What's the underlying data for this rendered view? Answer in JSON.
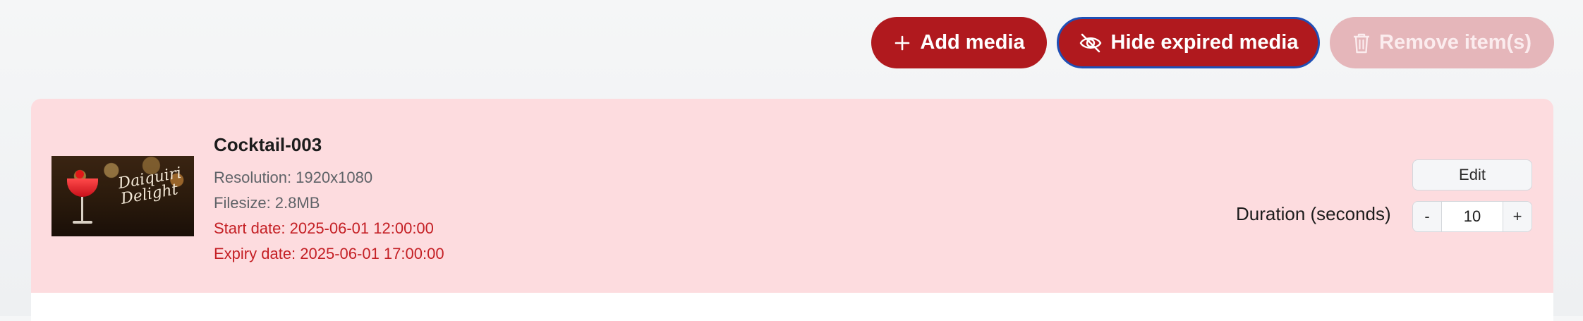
{
  "toolbar": {
    "add_label": "Add media",
    "hide_label": "Hide expired media",
    "remove_label": "Remove item(s)",
    "add_icon": "plus-icon",
    "hide_icon": "eye-off-icon",
    "remove_icon": "trash-icon"
  },
  "media_item": {
    "title": "Cocktail-003",
    "resolution": "Resolution: 1920x1080",
    "filesize": "Filesize: 2.8MB",
    "start_date": "Start date: 2025-06-01 12:00:00",
    "expiry_date": "Expiry date: 2025-06-01 17:00:00",
    "thumbnail_text": "Daiquiri Delight",
    "duration_label": "Duration (seconds)",
    "edit_label": "Edit",
    "duration_value": "10",
    "minus_label": "-",
    "plus_label": "+"
  },
  "colors": {
    "primary": "#b0191e",
    "disabled": "#e5b6ba",
    "expired_row": "#fddcdf",
    "date_text": "#c41f24",
    "focus_ring": "#1f4fb5"
  }
}
